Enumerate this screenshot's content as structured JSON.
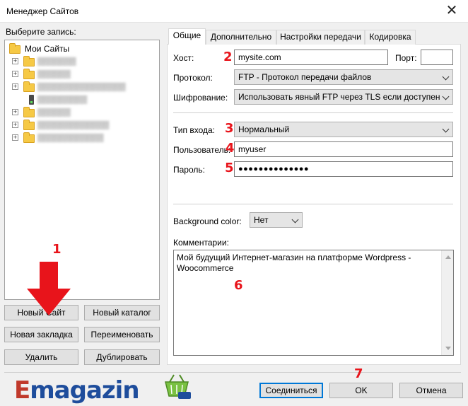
{
  "window": {
    "title": "Менеджер Сайтов",
    "close_glyph": "✕"
  },
  "left_panel": {
    "select_label": "Выберите запись:",
    "tree": {
      "root": "Мои Сайты",
      "items": [
        {
          "expander": "+",
          "text": "▒▒▒▒▒▒▒"
        },
        {
          "expander": "+",
          "text": "▒▒▒▒▒▒"
        },
        {
          "expander": "+",
          "text": "▒▒▒▒▒▒▒▒▒▒▒▒▒▒▒▒"
        },
        {
          "expander": "",
          "text": "▒▒▒▒▒▒▒▒▒"
        },
        {
          "expander": "+",
          "text": "▒▒▒▒▒▒"
        },
        {
          "expander": "+",
          "text": "▒▒▒▒▒▒▒▒▒▒▒▒▒"
        },
        {
          "expander": "+",
          "text": "▒▒▒▒▒▒▒▒▒▒▒▒"
        }
      ]
    },
    "buttons": {
      "new_site": "Новый Сайт",
      "new_folder": "Новый каталог",
      "new_bookmark": "Новая закладка",
      "rename": "Переименовать",
      "delete": "Удалить",
      "duplicate": "Дублировать"
    }
  },
  "tabs": [
    "Общие",
    "Дополнительно",
    "Настройки передачи",
    "Кодировка"
  ],
  "general": {
    "host_label": "Хост:",
    "host_value": "mysite.com",
    "port_label": "Порт:",
    "port_value": "",
    "protocol_label": "Протокол:",
    "protocol_value": "FTP - Протокол передачи файлов",
    "encryption_label": "Шифрование:",
    "encryption_value": "Использовать явный FTP через TLS если доступен",
    "logon_type_label": "Тип входа:",
    "logon_type_value": "Нормальный",
    "user_label": "Пользователь:",
    "user_value": "myuser",
    "password_label": "Пароль:",
    "password_value": "●●●●●●●●●●●●●●",
    "bg_color_label": "Background color:",
    "bg_color_value": "Нет",
    "comments_label": "Комментарии:",
    "comments_value": "Мой будущий Интернет-магазин на платформе Wordpress - Woocommerce"
  },
  "bottom_buttons": {
    "connect": "Соединиться",
    "ok": "OK",
    "cancel": "Отмена"
  },
  "annotations": [
    "1",
    "2",
    "3",
    "4",
    "5",
    "6",
    "7"
  ],
  "logo": {
    "first_letter": "E",
    "rest": "magazin"
  },
  "colors": {
    "annotation": "#e8141b",
    "folder": "#f6c945",
    "focus_border": "#0078d7"
  }
}
